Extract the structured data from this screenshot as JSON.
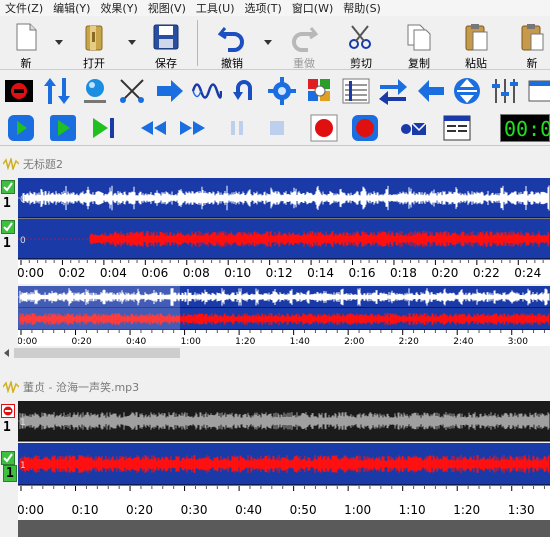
{
  "menu": [
    "文件(Z)",
    "编辑(Y)",
    "效果(Y)",
    "视图(V)",
    "工具(U)",
    "选项(T)",
    "窗口(W)",
    "帮助(S)"
  ],
  "toolbar": {
    "new_label": "新",
    "open_label": "打开",
    "save_label": "保存",
    "undo_label": "撤销",
    "redo_label": "重做",
    "cut_label": "剪切",
    "copy_label": "复制",
    "paste_label": "粘贴",
    "new2_label": "新"
  },
  "transport": {
    "counter": "00:0"
  },
  "doc1": {
    "title": "无标题2",
    "channels": [
      "1",
      "1"
    ],
    "ruler_ticks": [
      "0:00",
      "0:02",
      "0:04",
      "0:06",
      "0:08",
      "0:10",
      "0:12",
      "0:14",
      "0:16",
      "0:18",
      "0:20",
      "0:22",
      "0:24"
    ],
    "overview_ticks": [
      "0:00",
      "0:20",
      "0:40",
      "1:00",
      "1:20",
      "1:40",
      "2:00",
      "2:20",
      "2:40",
      "3:00"
    ],
    "channel_mark": "0"
  },
  "doc2": {
    "title": "董贞 - 沧海一声笑.mp3",
    "channels": [
      "1",
      "1"
    ],
    "ruler_ticks": [
      "0:00",
      "0:10",
      "0:20",
      "0:30",
      "0:40",
      "0:50",
      "1:00",
      "1:10",
      "1:20",
      "1:30"
    ],
    "channel_mark": "1"
  },
  "colors": {
    "wave_bg": "#1a3aa8",
    "wave_white": "#ffffff",
    "wave_red": "#ff1010",
    "muted_bg": "#1b1b1b",
    "muted_wave": "#a0a0a0",
    "counter_fg": "#21e021"
  },
  "icons": {
    "toolbar2": [
      "no-entry-icon",
      "vertical-arrows-icon",
      "globe-icon",
      "scissors-connect-icon",
      "arrow-right-branch-icon",
      "sine-wave-icon",
      "loop-back-icon",
      "gear-icon",
      "color-squares-icon",
      "staff-note-icon",
      "swap-arrows-icon",
      "arrow-left-icon",
      "expand-vertical-icon",
      "equalizer-icon",
      "window-icon"
    ],
    "toolbar3": [
      "play-loop-icon",
      "play-selection-icon",
      "play-to-end-icon",
      "rewind-icon",
      "fast-forward-icon",
      "pause-icon",
      "stop-icon",
      "record-icon",
      "record-loop-icon",
      "mail-icon",
      "mixer-window-icon"
    ]
  }
}
